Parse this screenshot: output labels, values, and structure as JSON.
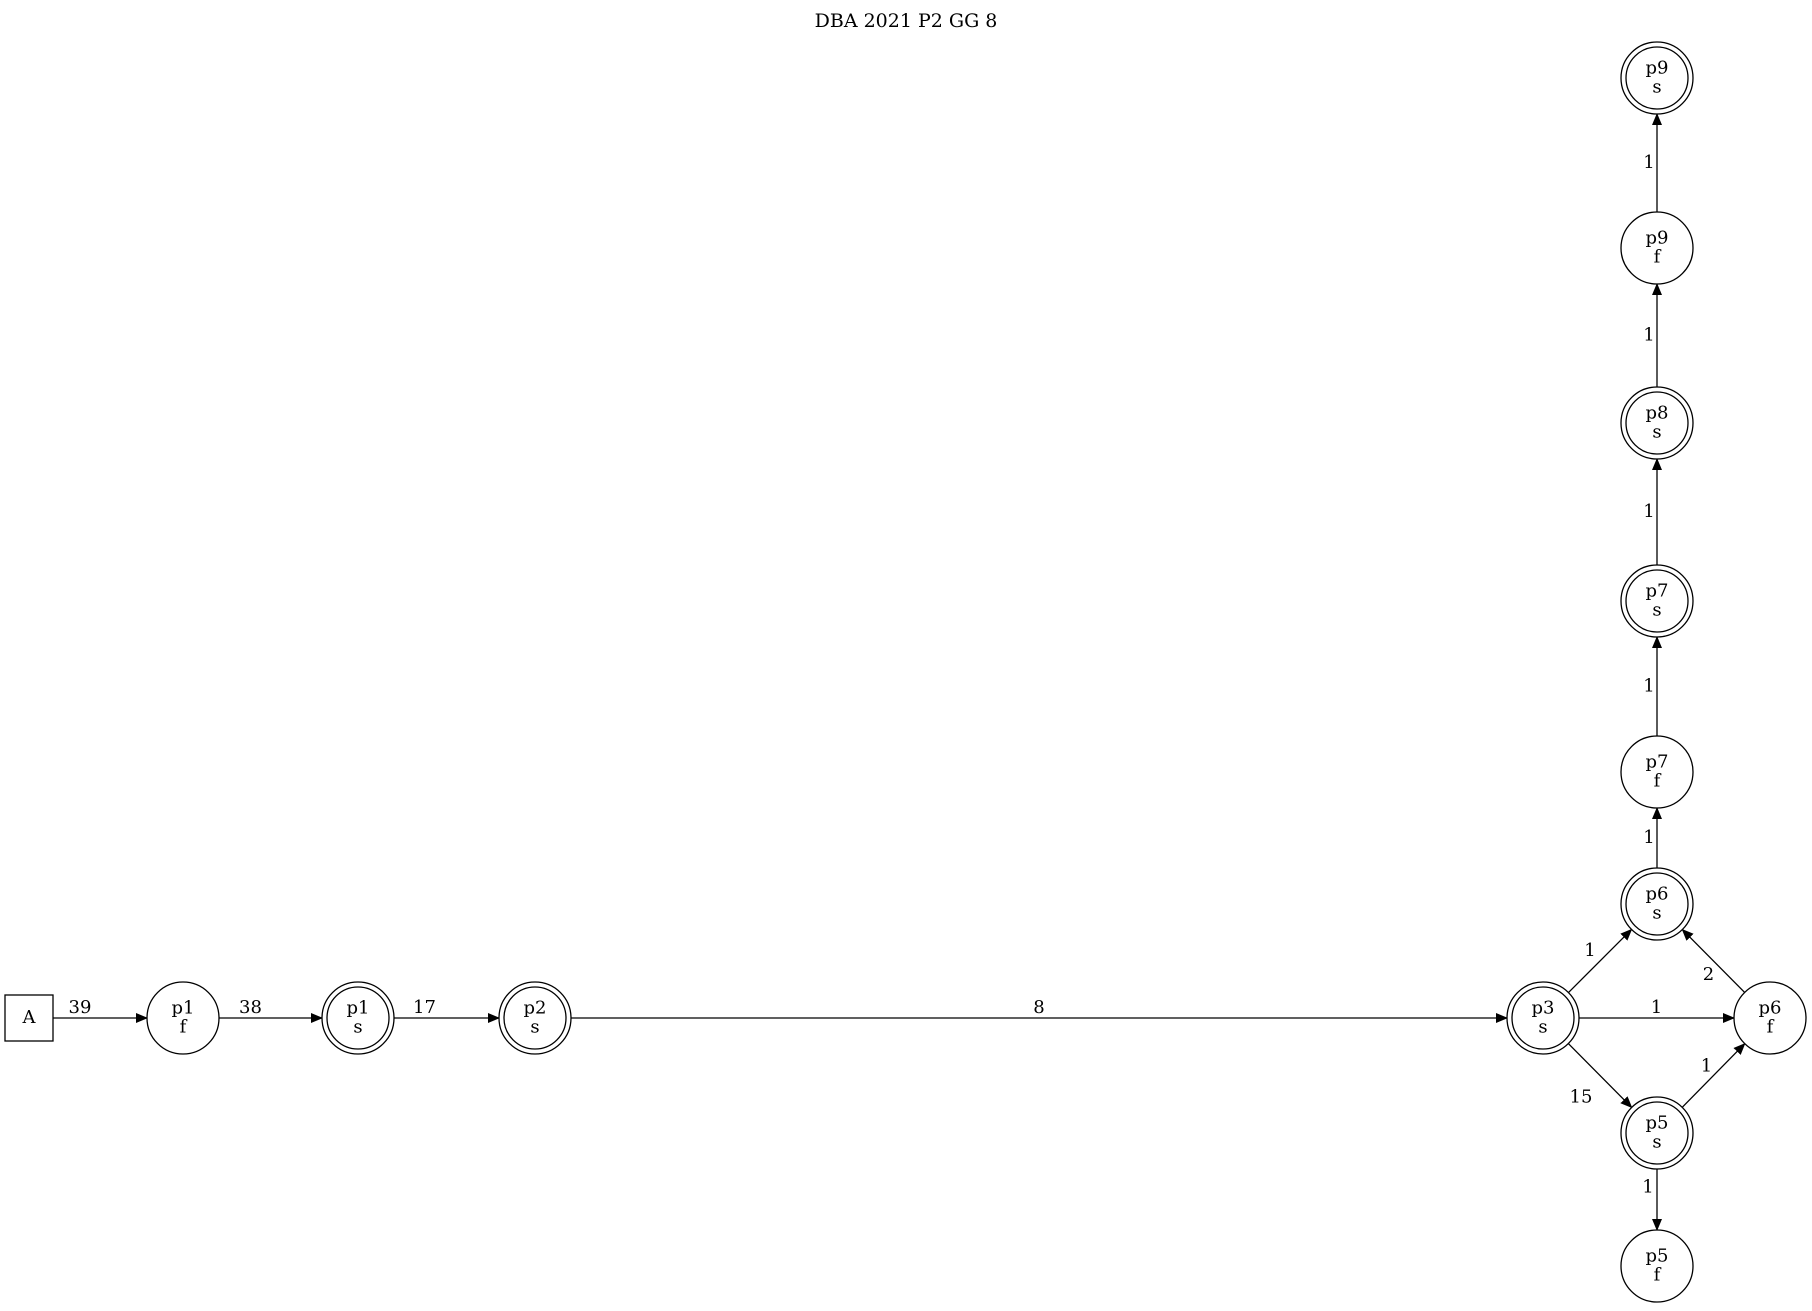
{
  "title": "DBA 2021 P2 GG 8",
  "nodes": [
    {
      "id": "A",
      "lines": [
        "A"
      ],
      "shape": "box"
    },
    {
      "id": "p1f",
      "lines": [
        "p1",
        "f"
      ],
      "shape": "circle"
    },
    {
      "id": "p1s",
      "lines": [
        "p1",
        "s"
      ],
      "shape": "doublecircle"
    },
    {
      "id": "p2s",
      "lines": [
        "p2",
        "s"
      ],
      "shape": "doublecircle"
    },
    {
      "id": "p3s",
      "lines": [
        "p3",
        "s"
      ],
      "shape": "doublecircle"
    },
    {
      "id": "p6s",
      "lines": [
        "p6",
        "s"
      ],
      "shape": "doublecircle"
    },
    {
      "id": "p6f",
      "lines": [
        "p6",
        "f"
      ],
      "shape": "circle"
    },
    {
      "id": "p5s",
      "lines": [
        "p5",
        "s"
      ],
      "shape": "doublecircle"
    },
    {
      "id": "p5f",
      "lines": [
        "p5",
        "f"
      ],
      "shape": "circle"
    },
    {
      "id": "p7f",
      "lines": [
        "p7",
        "f"
      ],
      "shape": "circle"
    },
    {
      "id": "p7s",
      "lines": [
        "p7",
        "s"
      ],
      "shape": "doublecircle"
    },
    {
      "id": "p8s",
      "lines": [
        "p8",
        "s"
      ],
      "shape": "doublecircle"
    },
    {
      "id": "p9f",
      "lines": [
        "p9",
        "f"
      ],
      "shape": "circle"
    },
    {
      "id": "p9s",
      "lines": [
        "p9",
        "s"
      ],
      "shape": "doublecircle"
    }
  ],
  "edges": [
    {
      "from": "A",
      "to": "p1f",
      "label": "39"
    },
    {
      "from": "p1f",
      "to": "p1s",
      "label": "38"
    },
    {
      "from": "p1s",
      "to": "p2s",
      "label": "17"
    },
    {
      "from": "p2s",
      "to": "p3s",
      "label": "8"
    },
    {
      "from": "p3s",
      "to": "p6s",
      "label": "1"
    },
    {
      "from": "p3s",
      "to": "p6f",
      "label": "1"
    },
    {
      "from": "p3s",
      "to": "p5s",
      "label": "15"
    },
    {
      "from": "p6f",
      "to": "p6s",
      "label": "2"
    },
    {
      "from": "p5s",
      "to": "p6f",
      "label": "1"
    },
    {
      "from": "p5s",
      "to": "p5f",
      "label": "1"
    },
    {
      "from": "p6s",
      "to": "p7f",
      "label": "1"
    },
    {
      "from": "p7f",
      "to": "p7s",
      "label": "1"
    },
    {
      "from": "p7s",
      "to": "p8s",
      "label": "1"
    },
    {
      "from": "p8s",
      "to": "p9f",
      "label": "1"
    },
    {
      "from": "p9f",
      "to": "p9s",
      "label": "1"
    }
  ]
}
